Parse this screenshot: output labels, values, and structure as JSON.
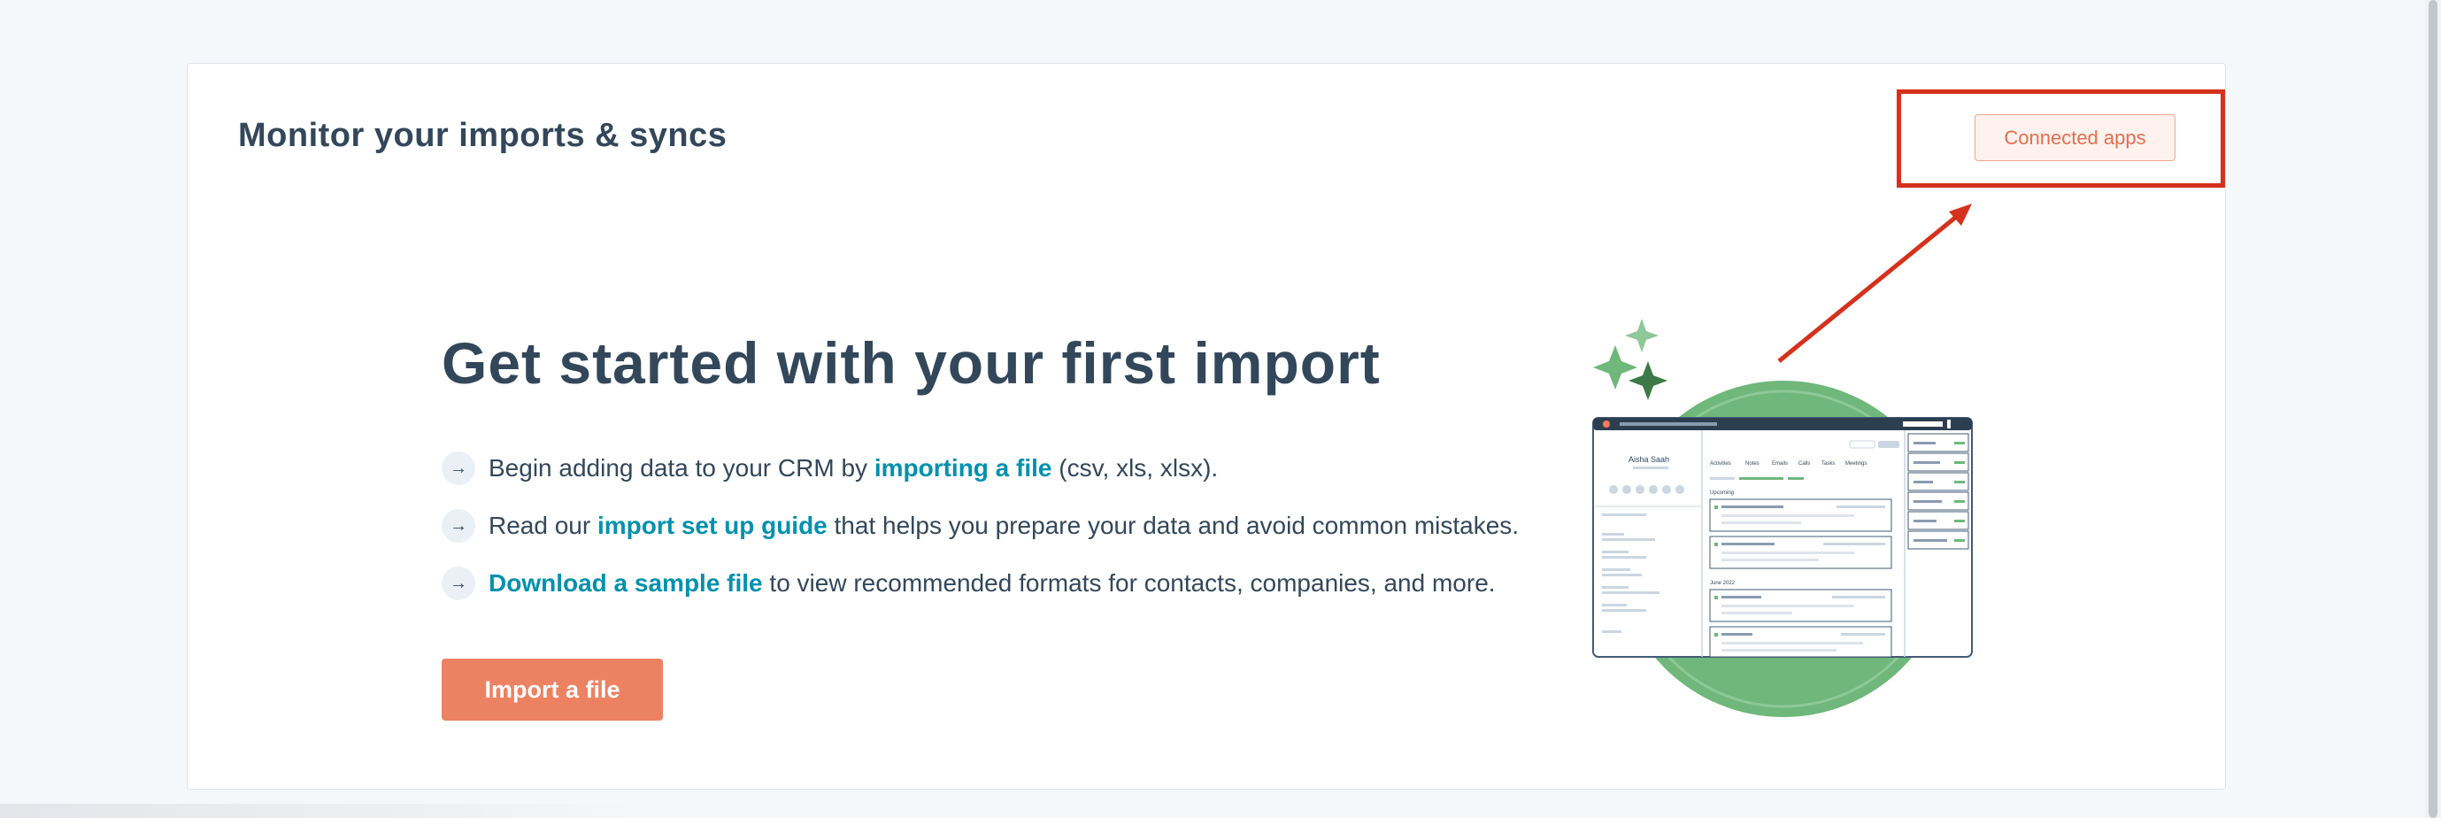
{
  "header": {
    "title": "Monitor your imports & syncs",
    "connected_apps_label": "Connected apps"
  },
  "hero": {
    "title": "Get started with your first import",
    "bullets": [
      {
        "before": "Begin adding data to your CRM by ",
        "link": "importing a file",
        "after": " (csv, xls, xlsx)."
      },
      {
        "before": "Read our ",
        "link": "import set up guide",
        "after": " that helps you prepare your data and avoid common mistakes."
      },
      {
        "before": "",
        "link": "Download a sample file",
        "after": " to view recommended formats for contacts, companies, and more."
      }
    ],
    "import_button_label": "Import a file",
    "arrow_icon": "arrow-right-icon"
  },
  "illustration": {
    "contact_name": "Aisha Saah",
    "tabs": [
      "Activities",
      "Notes",
      "Emails",
      "Calls",
      "Tasks",
      "Meetings"
    ],
    "section_upcoming": "Upcoming",
    "section_past": "June 2022"
  },
  "colors": {
    "accent": "#ed8262",
    "link": "#0091ae",
    "highlight": "#d5311c",
    "text": "#33475b",
    "illustration_green": "#6fb77a"
  }
}
